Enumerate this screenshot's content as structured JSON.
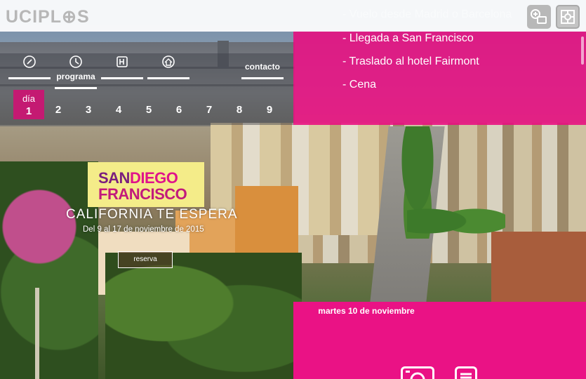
{
  "header": {
    "logo": "UCIPL⊕S",
    "icons": [
      "contact-card-icon",
      "settings-icon"
    ]
  },
  "nav": {
    "items": [
      {
        "label": "",
        "icon": "info-icon"
      },
      {
        "label": "programa",
        "icon": "clock-icon"
      },
      {
        "label": "",
        "icon": "hotel-icon"
      },
      {
        "label": "",
        "icon": "home-icon"
      },
      {
        "label": "contacto",
        "icon": ""
      }
    ]
  },
  "days": {
    "label": "día",
    "numbers": [
      "1",
      "2",
      "3",
      "4",
      "5",
      "6",
      "7",
      "8",
      "9"
    ],
    "active": "1"
  },
  "schedule": {
    "items": [
      "- Vuelo desde Madrid o Barcelona",
      "- Llegada a San Francisco",
      "- Traslado al hotel Fairmont",
      "- Cena"
    ]
  },
  "promo": {
    "san": "SAN",
    "diego": "DIEGO",
    "francisco": "FRANCISCO",
    "tagline": "CALIFORNIA TE ESPERA",
    "dates": "Del 9 al 17 de noviembre de 2015",
    "cta": "reserva"
  },
  "next_day": {
    "title": "martes 10 de noviembre",
    "icons": [
      "camera-icon",
      "document-icon"
    ]
  },
  "colors": {
    "magenta": "#e80c80",
    "active_day": "#c41a72",
    "promo_bg": "#f4ec89"
  }
}
